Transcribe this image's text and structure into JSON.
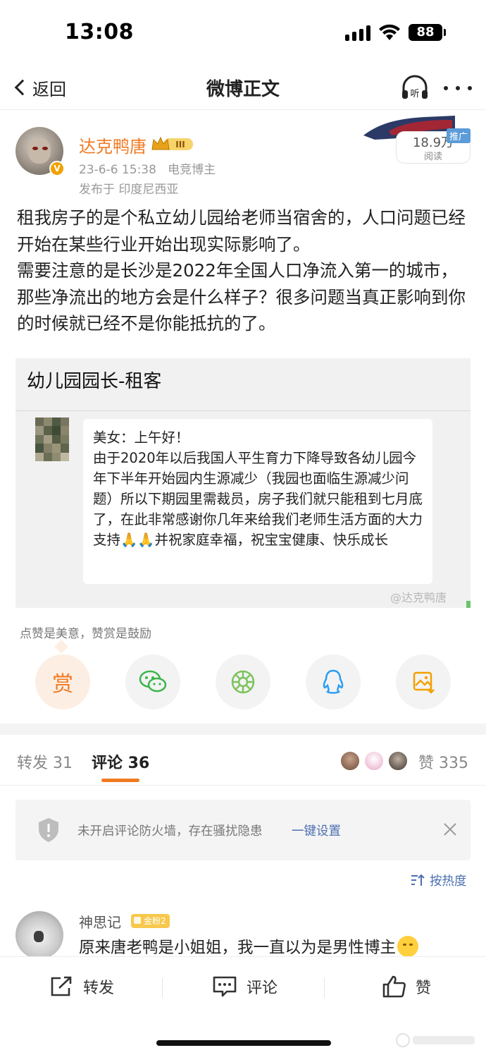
{
  "status_bar": {
    "time": "13:08",
    "battery": "88"
  },
  "nav": {
    "back_label": "返回",
    "title": "微博正文",
    "listen_icon_label": "听"
  },
  "post": {
    "author": "达克鸭唐",
    "author_level": "III",
    "verified_mark": "V",
    "date": "23-6-6 15:38",
    "author_tag": "电竞博主",
    "location": "发布于 印度尼西亚",
    "read_count": "18.9万",
    "read_label": "阅读",
    "ad_tag": "推广",
    "text_line1": "租我房子的是个私立幼儿园给老师当宿舍的，人口问题已经开始在某些行业开始出现实际影响了。",
    "text_line2": "需要注意的是长沙是2022年全国人口净流入第一的城市，那些净流出的地方会是什么样子？很多问题当真正影响到你的时候就已经不是你能抵抗的了。"
  },
  "embedded_image": {
    "chat_title": "幼儿园园长-租客",
    "message_greeting": "美女：上午好！",
    "message_body": "由于2020年以后我国人平生育力下降导致各幼儿园今年下半年开始园内生源减少（我园也面临生源减少问题）所以下期园里需裁员，房子我们就只能租到七月底了，在此非常感谢你几年来给我们老师生活方面的大力支持🙏🙏并祝家庭幸福，祝宝宝健康、快乐成长",
    "watermark": "@达克鸭唐"
  },
  "reward": {
    "hint": "点赞是美意，赞赏是鼓励",
    "reward_label": "赏"
  },
  "share_icons": [
    "reward-icon",
    "wechat-icon",
    "moments-icon",
    "qq-icon",
    "save-image-icon"
  ],
  "tabs": {
    "repost": "转发 31",
    "comments": "评论 36",
    "likes": "赞 335"
  },
  "notice": {
    "text": "未开启评论防火墙，存在骚扰隐患",
    "link": "一键设置"
  },
  "sort": {
    "label": "按热度"
  },
  "comment": {
    "name": "神思记",
    "badge": "金粉2",
    "text": "原来唐老鸭是小姐姐，我一直以为是男性博主"
  },
  "actions": {
    "repost": "转发",
    "comment": "评论",
    "like": "赞"
  },
  "colors": {
    "accent": "#f07a22",
    "link": "#4c6fb0",
    "name": "#f07a22"
  }
}
